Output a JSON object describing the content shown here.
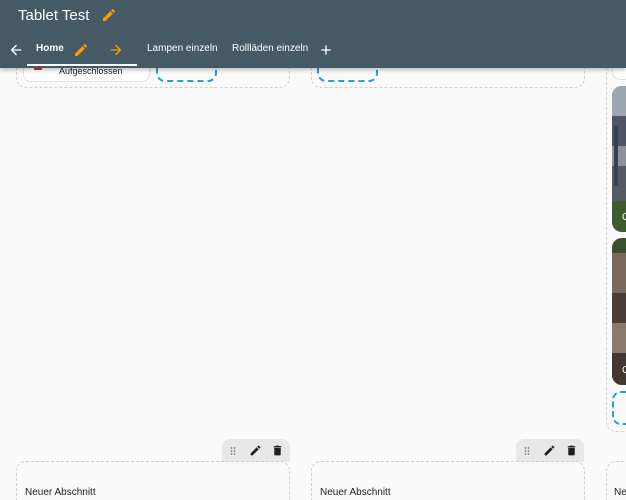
{
  "header": {
    "title": "Tablet Test",
    "tabs": [
      {
        "label": "Home"
      },
      {
        "label": "Lampen einzeln"
      },
      {
        "label": "Rollläden einzeln"
      }
    ]
  },
  "lock_card": {
    "state": "Aufgeschlossen"
  },
  "cameras": [
    {
      "label": "G"
    },
    {
      "label": "G"
    }
  ],
  "new_sections": [
    {
      "label": "Neuer Abschnitt"
    },
    {
      "label": "Neuer Abschnitt"
    },
    {
      "label": "Ne"
    }
  ],
  "colors": {
    "header": "#455a64",
    "accent": "#ff9800",
    "dashed_add": "#1fa2d6",
    "lock_status": "#d32f2f"
  }
}
